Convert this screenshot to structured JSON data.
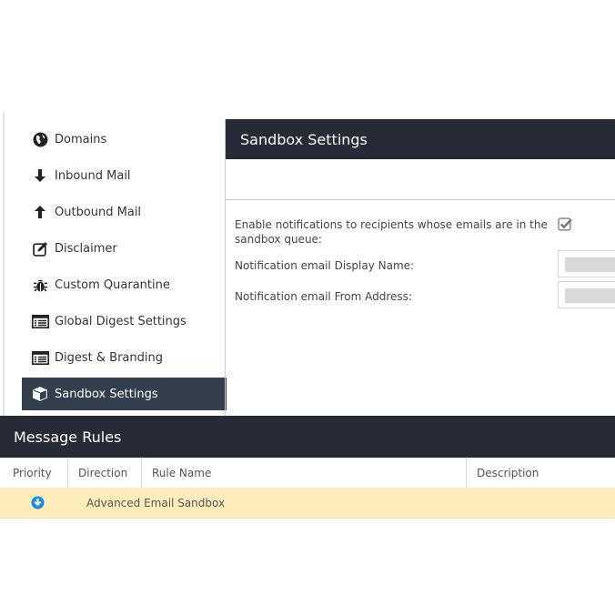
{
  "sidebar": {
    "items": [
      {
        "label": "Domains",
        "icon": "globe-icon",
        "active": false
      },
      {
        "label": "Inbound Mail",
        "icon": "arrow-down-icon",
        "active": false
      },
      {
        "label": "Outbound Mail",
        "icon": "arrow-up-icon",
        "active": false
      },
      {
        "label": "Disclaimer",
        "icon": "edit-icon",
        "active": false
      },
      {
        "label": "Custom Quarantine",
        "icon": "bug-icon",
        "active": false
      },
      {
        "label": "Global Digest Settings",
        "icon": "list-icon",
        "active": false
      },
      {
        "label": "Digest & Branding",
        "icon": "list-icon",
        "active": false
      },
      {
        "label": "Sandbox Settings",
        "icon": "cube-icon",
        "active": true
      }
    ]
  },
  "main": {
    "title": "Sandbox Settings",
    "fields": {
      "enable_notifications": {
        "label_line1": "Enable notifications to recipients whose emails are in the",
        "label_line2": "sandbox queue:",
        "checked": true
      },
      "display_name": {
        "label": "Notification email Display Name:",
        "value": ""
      },
      "from_address": {
        "label": "Notification email From Address:",
        "value": ""
      }
    }
  },
  "rules": {
    "title": "Message Rules",
    "columns": [
      "Priority",
      "Direction",
      "Rule Name",
      "Description"
    ],
    "rows": [
      {
        "priority_icon": "arrow-circle-down-icon",
        "direction": "",
        "rule_name": "Advanced Email Sandbox",
        "description": ""
      }
    ]
  },
  "colors": {
    "header_bg": "#262b35",
    "active_nav_bg": "#333f4d",
    "row_highlight": "#fdedbb",
    "priority_icon": "#1a8fe0"
  }
}
